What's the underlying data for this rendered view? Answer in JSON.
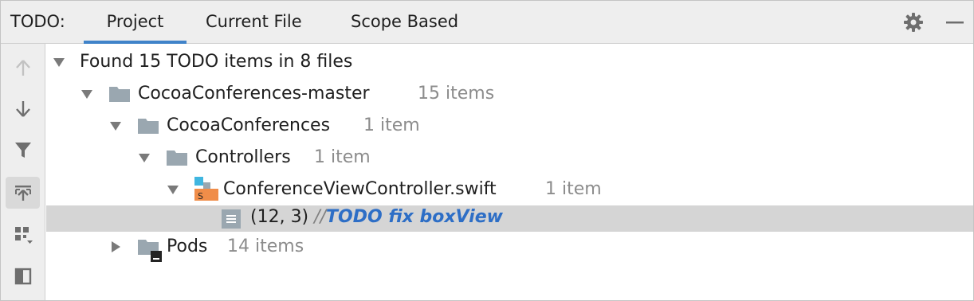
{
  "header": {
    "title": "TODO:",
    "tabs": [
      {
        "label": "Project",
        "selected": true
      },
      {
        "label": "Current File",
        "selected": false
      },
      {
        "label": "Scope Based",
        "selected": false
      }
    ],
    "icons": [
      "gear-icon",
      "minimize-icon"
    ]
  },
  "toolbar": {
    "buttons": [
      {
        "name": "previous-occurrence-icon",
        "enabled": false
      },
      {
        "name": "next-occurrence-icon",
        "enabled": true
      },
      {
        "name": "filter-icon",
        "enabled": true
      },
      {
        "name": "autoscroll-to-source-icon",
        "active": true
      },
      {
        "name": "group-by-icon",
        "enabled": true
      },
      {
        "name": "preview-panel-icon",
        "enabled": true
      }
    ]
  },
  "tree": {
    "root": {
      "label": "Found 15 TODO items in 8 files"
    },
    "project": {
      "label": "CocoaConferences-master",
      "count": "15 items"
    },
    "module": {
      "label": "CocoaConferences",
      "count": "1 item"
    },
    "controllers": {
      "label": "Controllers",
      "count": "1 item"
    },
    "file": {
      "label": "ConferenceViewController.swift",
      "count": "1 item"
    },
    "todo": {
      "position": "(12, 3)",
      "comment_prefix": "//",
      "text": "TODO fix boxView"
    },
    "pods": {
      "label": "Pods",
      "count": "14 items"
    }
  },
  "colors": {
    "accent": "#4083c9",
    "todo_text": "#2d6ec6",
    "selection": "#d5d5d5",
    "panel_bg": "#eeeeee",
    "folder": "#9aa7b0",
    "swift": "#f08d49"
  }
}
